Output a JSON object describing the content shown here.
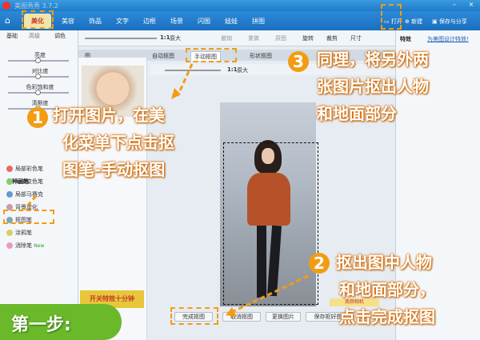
{
  "window": {
    "title": "美图秀秀 3.7.2",
    "minimize": "–",
    "close": "×"
  },
  "tabs": [
    {
      "label": "美化",
      "active": true
    },
    {
      "label": "美容"
    },
    {
      "label": "饰品"
    },
    {
      "label": "文字"
    },
    {
      "label": "边框"
    },
    {
      "label": "场景"
    },
    {
      "label": "闪图"
    },
    {
      "label": "娃娃"
    },
    {
      "label": "拼图"
    }
  ],
  "top_buttons": {
    "open": "打开",
    "new": "新建",
    "save": "保存与分享"
  },
  "left_panel": {
    "subtabs": [
      "基础",
      "高级",
      "调色"
    ],
    "sliders": [
      "亮度",
      "对比度",
      "色彩饱和度",
      "清晰度"
    ],
    "brush_heading": "各种画笔",
    "brushes": [
      "局部彩色笔",
      "局部变色笔",
      "局部马赛克",
      "背景虚化",
      "抠图笔",
      "涂鸦笔",
      "消除笔"
    ],
    "new_badge": "New"
  },
  "toolbar": {
    "zoom_label": "1:1",
    "original": "原大",
    "undo": "撤销",
    "redo": "重做",
    "reset": "原图",
    "rotate": "旋转",
    "crop": "裁剪",
    "size": "尺寸"
  },
  "canvas": {
    "tabs": [
      {
        "label": "图"
      },
      {
        "label": "自动抠图"
      },
      {
        "label": "手动抠图",
        "active": true
      },
      {
        "label": "形状抠图"
      }
    ],
    "sub_zoom": "1:1",
    "sub_original": "原大"
  },
  "right_panel": {
    "title": "特效",
    "link": "为美图设计特效!"
  },
  "bottom_buttons": [
    "完成抠图",
    "取消抠图",
    "更换图片",
    "保存抠好图"
  ],
  "promo": {
    "text": "开关特效十分钟",
    "text2": "美颜相机"
  },
  "annotations": {
    "step1_num": "1",
    "step1_text": [
      "打开图片，在美",
      "化菜单下点击抠",
      "图笔-手动抠图"
    ],
    "step2_num": "2",
    "step2_text": [
      "抠出图中人物",
      "和地面部分，",
      "点击完成抠图"
    ],
    "step3_num": "3",
    "step3_text": [
      "同理，将另外两",
      "张图片抠出人物",
      "和地面部分"
    ],
    "step_label": "第一步:"
  },
  "colors": {
    "accent": "#f39c12",
    "title_bar": "#1e7bc9",
    "step_green": "#69b92b"
  }
}
